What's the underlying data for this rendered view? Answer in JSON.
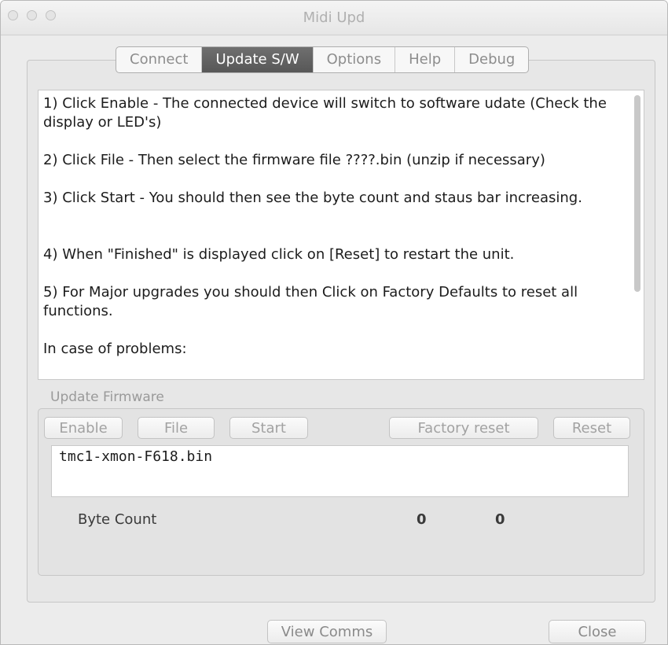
{
  "window": {
    "title": "Midi  Upd"
  },
  "tabs": [
    {
      "label": "Connect",
      "active": false
    },
    {
      "label": "Update S/W",
      "active": true
    },
    {
      "label": "Options",
      "active": false
    },
    {
      "label": "Help",
      "active": false
    },
    {
      "label": "Debug",
      "active": false
    }
  ],
  "instructions": [
    "1) Click Enable - The connected device will switch to software udate (Check the display or LED's)",
    "2) Click File - Then select the firmware file ????.bin (unzip if necessary)",
    "3) Click Start - You should then see the byte count and staus bar increasing.",
    "4) When \"Finished\" is displayed click on [Reset] to restart the unit.",
    "5) For Major upgrades you should then Click on Factory Defaults to reset all functions.",
    "In case of problems:"
  ],
  "update_firmware": {
    "label": "Update Firmware",
    "buttons": {
      "enable": "Enable",
      "file": "File",
      "start": "Start",
      "factory_reset": "Factory reset",
      "reset": "Reset"
    },
    "file_name": "tmc1-xmon-F618.bin",
    "byte_count_label": "Byte Count",
    "byte_count": "0",
    "total_count": "0"
  },
  "footer": {
    "view_comms": "View Comms",
    "close": "Close"
  },
  "colors": {
    "active_tab": "#616161",
    "window_bg": "#ececec"
  }
}
